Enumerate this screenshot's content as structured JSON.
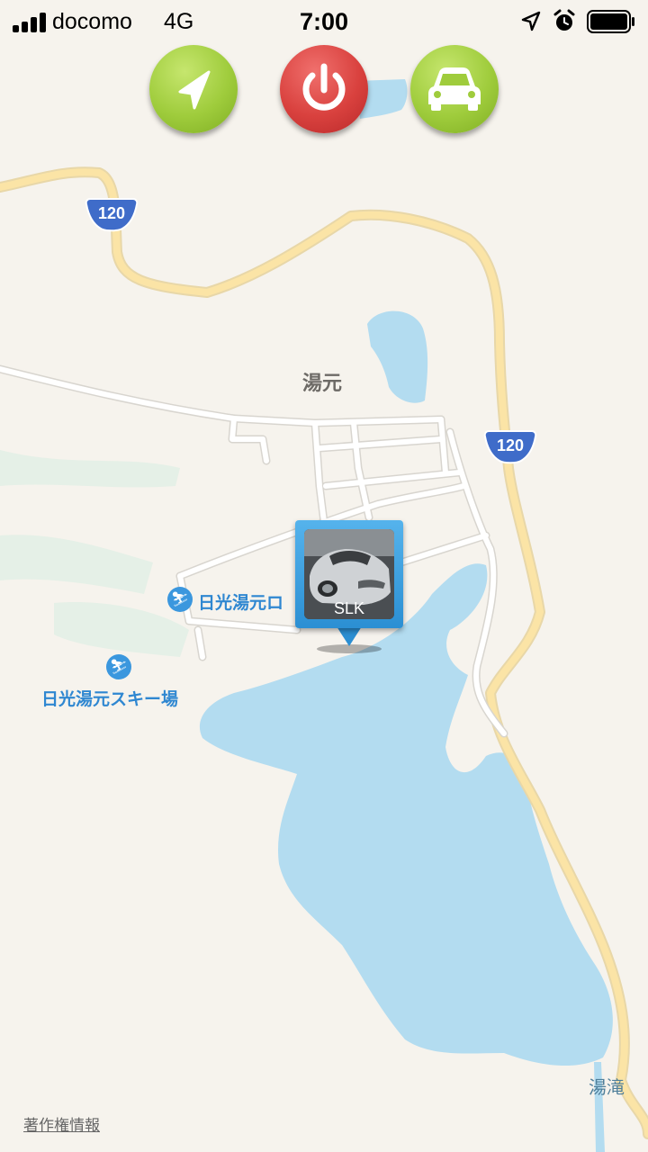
{
  "status_bar": {
    "carrier": "docomo",
    "network": "4G",
    "time": "7:00",
    "icons": [
      "signal-icon",
      "location-arrow-icon",
      "alarm-clock-icon",
      "battery-icon"
    ]
  },
  "toolbar": {
    "buttons": [
      {
        "name": "navigate",
        "icon": "location-arrow-icon",
        "color": "#9fcc3c"
      },
      {
        "name": "power",
        "icon": "power-icon",
        "color": "#d9413e"
      },
      {
        "name": "vehicle",
        "icon": "car-icon",
        "color": "#9fcc3c"
      }
    ]
  },
  "map": {
    "colors": {
      "land": "#f6f3ed",
      "water": "#b3dcf0",
      "major_road": "#fbe4a6",
      "minor_road": "#ffffff"
    },
    "route_shields": [
      {
        "number": "120"
      },
      {
        "number": "120"
      }
    ],
    "labels": {
      "town": "湯元",
      "poi_1": "日光湯元ロ",
      "poi_2": "日光湯元スキー場",
      "water": "湯滝"
    },
    "poi_icon": "skier-icon"
  },
  "vehicle_pin": {
    "label": "SLK",
    "icon": "car-photo"
  },
  "footer": {
    "copyright_link": "著作権情報"
  }
}
